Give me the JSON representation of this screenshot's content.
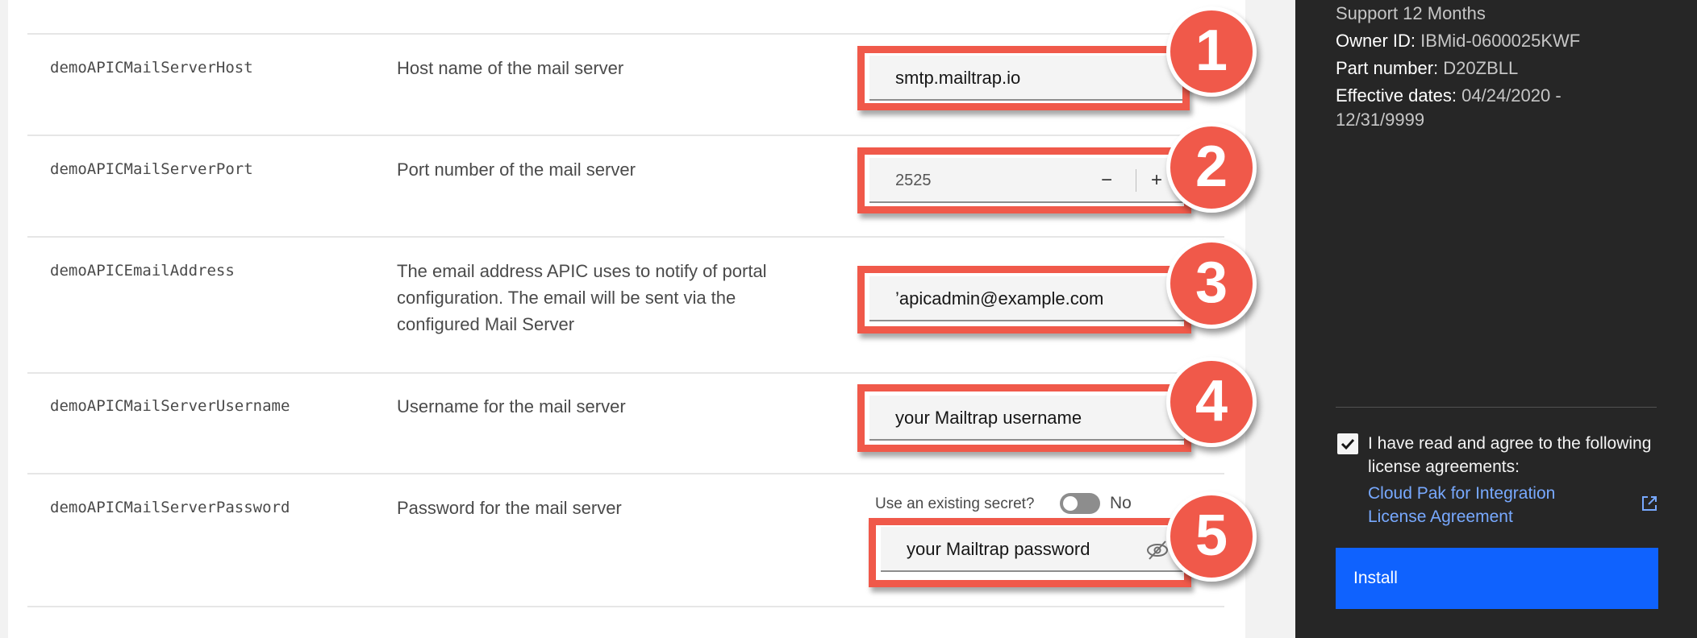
{
  "params": [
    {
      "name": "demoAPICMailServerHost",
      "desc": "Host name of the mail server",
      "value": "smtp.mailtrap.io",
      "badge": "1"
    },
    {
      "name": "demoAPICMailServerPort",
      "desc": "Port number of the mail server",
      "value": "2525",
      "badge": "2",
      "minus": "−",
      "plus": "+"
    },
    {
      "name": "demoAPICEmailAddress",
      "desc": "The email address APIC uses to notify of portal configuration. The email will be sent via the configured Mail Server",
      "value": "’apicadmin@example.com",
      "badge": "3"
    },
    {
      "name": "demoAPICMailServerUsername",
      "desc": "Username for the mail server",
      "value": "your Mailtrap username",
      "badge": "4"
    },
    {
      "name": "demoAPICMailServerPassword",
      "desc": "Password for the mail server",
      "value": "your Mailtrap password",
      "badge": "5"
    }
  ],
  "secret": {
    "label": "Use an existing secret?",
    "state": "No"
  },
  "sidebar": {
    "support": "Support 12 Months",
    "owner_label": "Owner ID:",
    "owner_value": "IBMid-0600025KWF",
    "part_label": "Part number:",
    "part_value": "D20ZBLL",
    "dates_label": "Effective dates:",
    "dates_value": "04/24/2020 - 12/31/9999",
    "agree_text": "I have read and agree to the following license agreements:",
    "license_link": "Cloud Pak for Integration License Agreement",
    "install_label": "Install"
  },
  "colors": {
    "callout": "#f0594a",
    "install": "#0f62fe",
    "link": "#78a9ff"
  }
}
